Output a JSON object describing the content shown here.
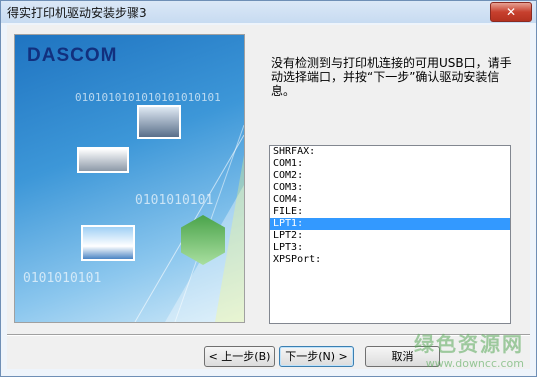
{
  "window": {
    "title": "得实打印机驱动安装步骤3",
    "close_symbol": "✕"
  },
  "art": {
    "logo": "DASCOM",
    "binary_lines": [
      "0101010101010101010101",
      "0101010101",
      "0101010101"
    ]
  },
  "instruction": "没有检测到与打印机连接的可用USB口，请手动选择端口，并按“下一步”确认驱动安装信息。",
  "ports": {
    "items": [
      "SHRFAX:",
      "COM1:",
      "COM2:",
      "COM3:",
      "COM4:",
      "FILE:",
      "LPT1:",
      "LPT2:",
      "LPT3:",
      "XPSPort:"
    ],
    "selected_index": 6
  },
  "buttons": {
    "back": "< 上一步(B)",
    "next": "下一步(N) >",
    "cancel": "取消"
  },
  "watermark": {
    "line1": "绿色资源网",
    "line2": "www.downcc.com"
  }
}
